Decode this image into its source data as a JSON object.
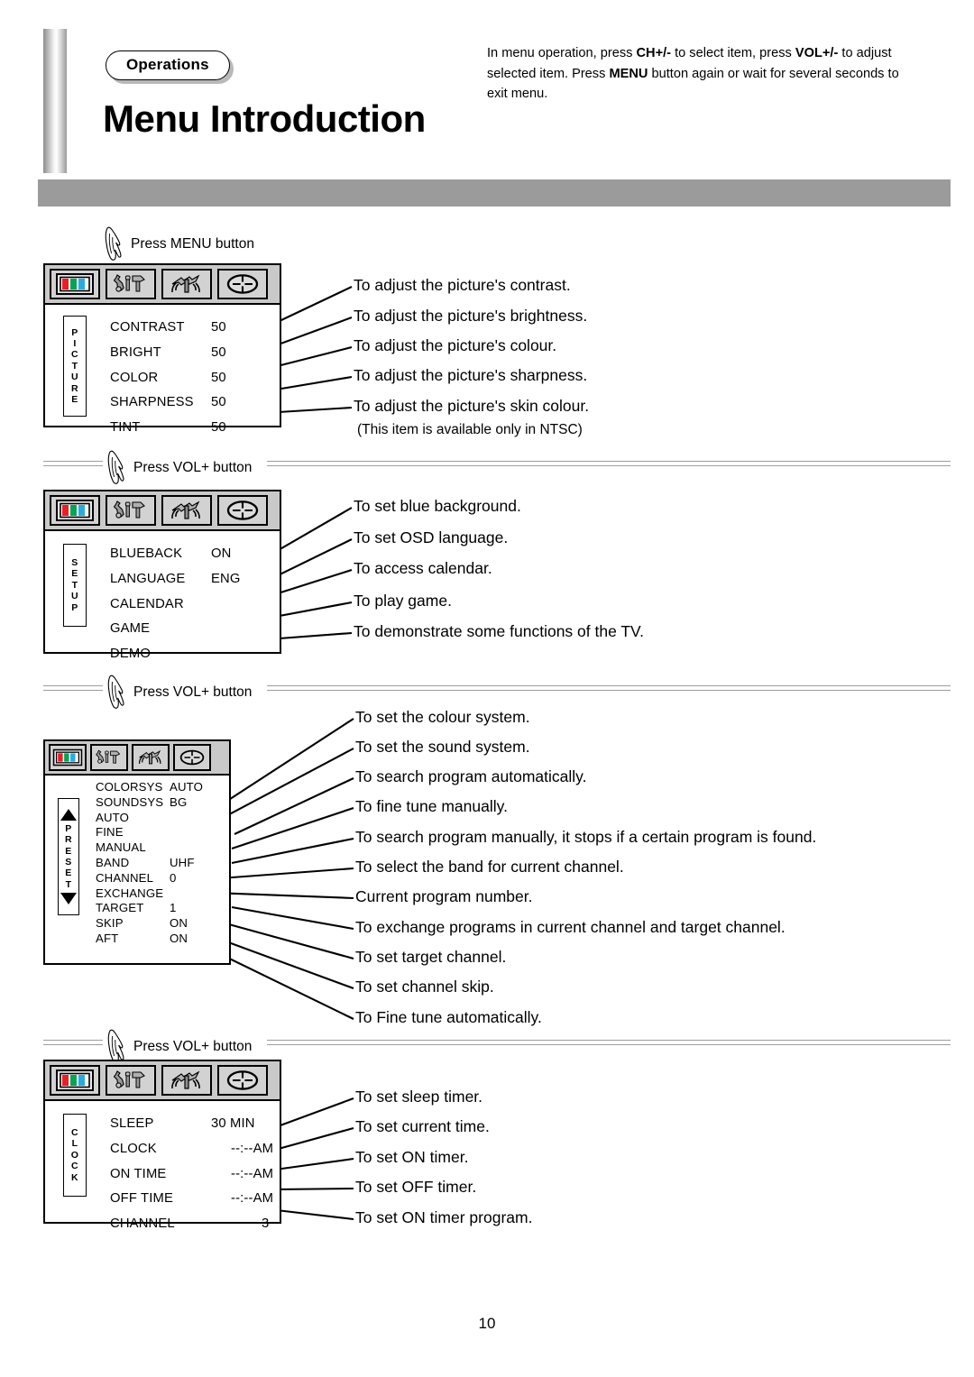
{
  "header": {
    "tag": "Operations",
    "title": "Menu Introduction",
    "intro_line1_a": "In menu operation, press ",
    "intro_line1_b": "CH+/-",
    "intro_line1_c": " to select item, press",
    "intro_line2_a": "VOL+/-",
    "intro_line2_b": " to adjust selected item. Press ",
    "intro_line2_c": "MENU",
    "intro_line2_d": " button",
    "intro_line3": "again or wait for several seconds to exit menu."
  },
  "press_labels": {
    "menu": "Press MENU button",
    "vol1": "Press VOL+ button",
    "vol2": "Press VOL+ button",
    "vol3": "Press VOL+ button"
  },
  "tab_icons": [
    "picture-tab-icon",
    "setup-tab-icon",
    "preset-tab-icon",
    "clock-tab-icon"
  ],
  "panels": [
    {
      "id": "picture",
      "vertical_label": "PICTURE",
      "rows": [
        {
          "label": "CONTRAST",
          "value": "50"
        },
        {
          "label": "BRIGHT",
          "value": "50"
        },
        {
          "label": "COLOR",
          "value": "50"
        },
        {
          "label": "SHARPNESS",
          "value": "50"
        },
        {
          "label": "TINT",
          "value": "50"
        }
      ],
      "descriptions": [
        "To  adjust the picture's contrast.",
        "To adjust the picture's brightness.",
        "To adjust the picture's colour.",
        "To adjust the picture's sharpness.",
        "To adjust the picture's skin colour."
      ],
      "sub_note": "(This item is available only in NTSC)"
    },
    {
      "id": "setup",
      "vertical_label": "SETUP",
      "rows": [
        {
          "label": "BLUEBACK",
          "value": "ON"
        },
        {
          "label": "LANGUAGE",
          "value": "ENG"
        },
        {
          "label": "CALENDAR",
          "value": ""
        },
        {
          "label": "GAME",
          "value": ""
        },
        {
          "label": "DEMO",
          "value": ""
        }
      ],
      "descriptions": [
        "To  set blue background.",
        "To set OSD language.",
        "To access calendar.",
        "To play game.",
        "To demonstrate some functions of the TV."
      ]
    },
    {
      "id": "preset",
      "vertical_label": "PRESET",
      "rows": [
        {
          "label": "COLORSYS",
          "value": "AUTO"
        },
        {
          "label": "SOUNDSYS",
          "value": "BG"
        },
        {
          "label": "AUTO",
          "value": ""
        },
        {
          "label": "FINE",
          "value": ""
        },
        {
          "label": "MANUAL",
          "value": ""
        },
        {
          "label": "BAND",
          "value": "UHF"
        },
        {
          "label": "CHANNEL",
          "value": "0"
        },
        {
          "label": "EXCHANGE",
          "value": ""
        },
        {
          "label": "TARGET",
          "value": "1"
        },
        {
          "label": "SKIP",
          "value": "ON"
        },
        {
          "label": "AFT",
          "value": "ON"
        }
      ],
      "descriptions": [
        "To set the colour system.",
        "To set the sound system.",
        "To search program automatically.",
        "To fine tune manually.",
        "To search program manually, it stops if a certain program is found.",
        "To select the band for current channel.",
        "Current program number.",
        "To exchange programs in current channel and target channel.",
        "To set target channel.",
        "To  set channel skip.",
        "To Fine tune automatically."
      ]
    },
    {
      "id": "clock",
      "vertical_label": "CLOCK",
      "rows": [
        {
          "label": "SLEEP",
          "value": "30 MIN"
        },
        {
          "label": "CLOCK",
          "value": "--:--AM"
        },
        {
          "label": "ON TIME",
          "value": "--:--AM"
        },
        {
          "label": "OFF TIME",
          "value": "--:--AM"
        },
        {
          "label": "CHANNEL",
          "value": "3"
        }
      ],
      "descriptions": [
        "To  set sleep timer.",
        "To set current time.",
        "To set ON timer.",
        "To set OFF timer.",
        "To set ON timer program."
      ]
    }
  ],
  "page_number": "10",
  "colors": {
    "band": "#9b9b9b",
    "tab_bg": "#c9c9c9",
    "icon_bg": "#d2d2d2",
    "rgb_red": "#ee1c24",
    "rgb_green": "#00a650",
    "rgb_blue": "#29abe2",
    "rule": "#9d9d9d"
  }
}
